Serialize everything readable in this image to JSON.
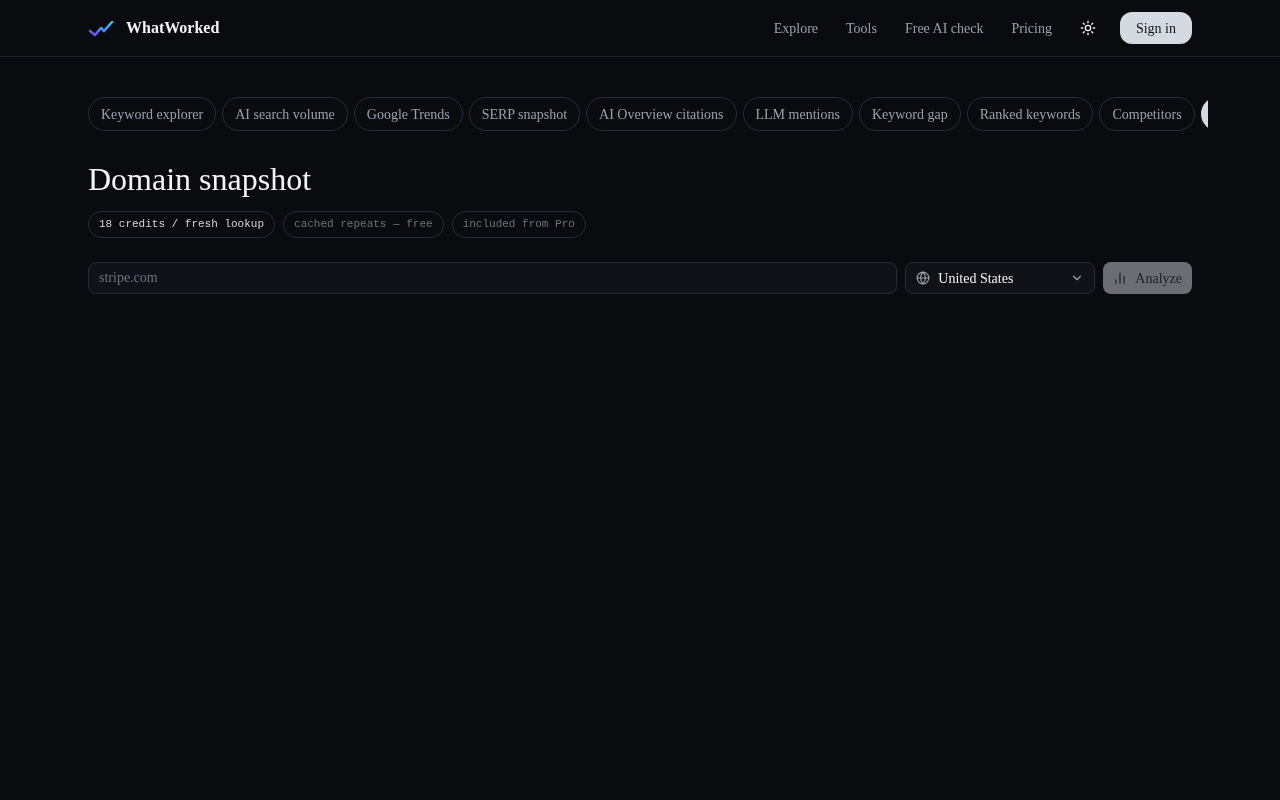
{
  "brand": {
    "name": "WhatWorked"
  },
  "nav": [
    "Explore",
    "Tools",
    "Free AI check",
    "Pricing"
  ],
  "sign_in": "Sign in",
  "tools": [
    {
      "label": "Keyword explorer",
      "selected": false
    },
    {
      "label": "AI search volume",
      "selected": false
    },
    {
      "label": "Google Trends",
      "selected": false
    },
    {
      "label": "SERP snapshot",
      "selected": false
    },
    {
      "label": "AI Overview citations",
      "selected": false
    },
    {
      "label": "LLM mentions",
      "selected": false
    },
    {
      "label": "Keyword gap",
      "selected": false
    },
    {
      "label": "Ranked keywords",
      "selected": false
    },
    {
      "label": "Competitors",
      "selected": false
    },
    {
      "selected": true
    }
  ],
  "title": "Domain snapshot",
  "badges": [
    {
      "label": "18 credits / fresh lookup",
      "emphasis": true
    },
    {
      "label": "cached repeats — free",
      "emphasis": false
    },
    {
      "label": "included from Pro",
      "emphasis": false
    }
  ],
  "domain_field": {
    "placeholder": "stripe.com"
  },
  "country_select": {
    "value": "United States"
  },
  "analyze_button": {
    "label": "Analyze",
    "disabled": true
  }
}
